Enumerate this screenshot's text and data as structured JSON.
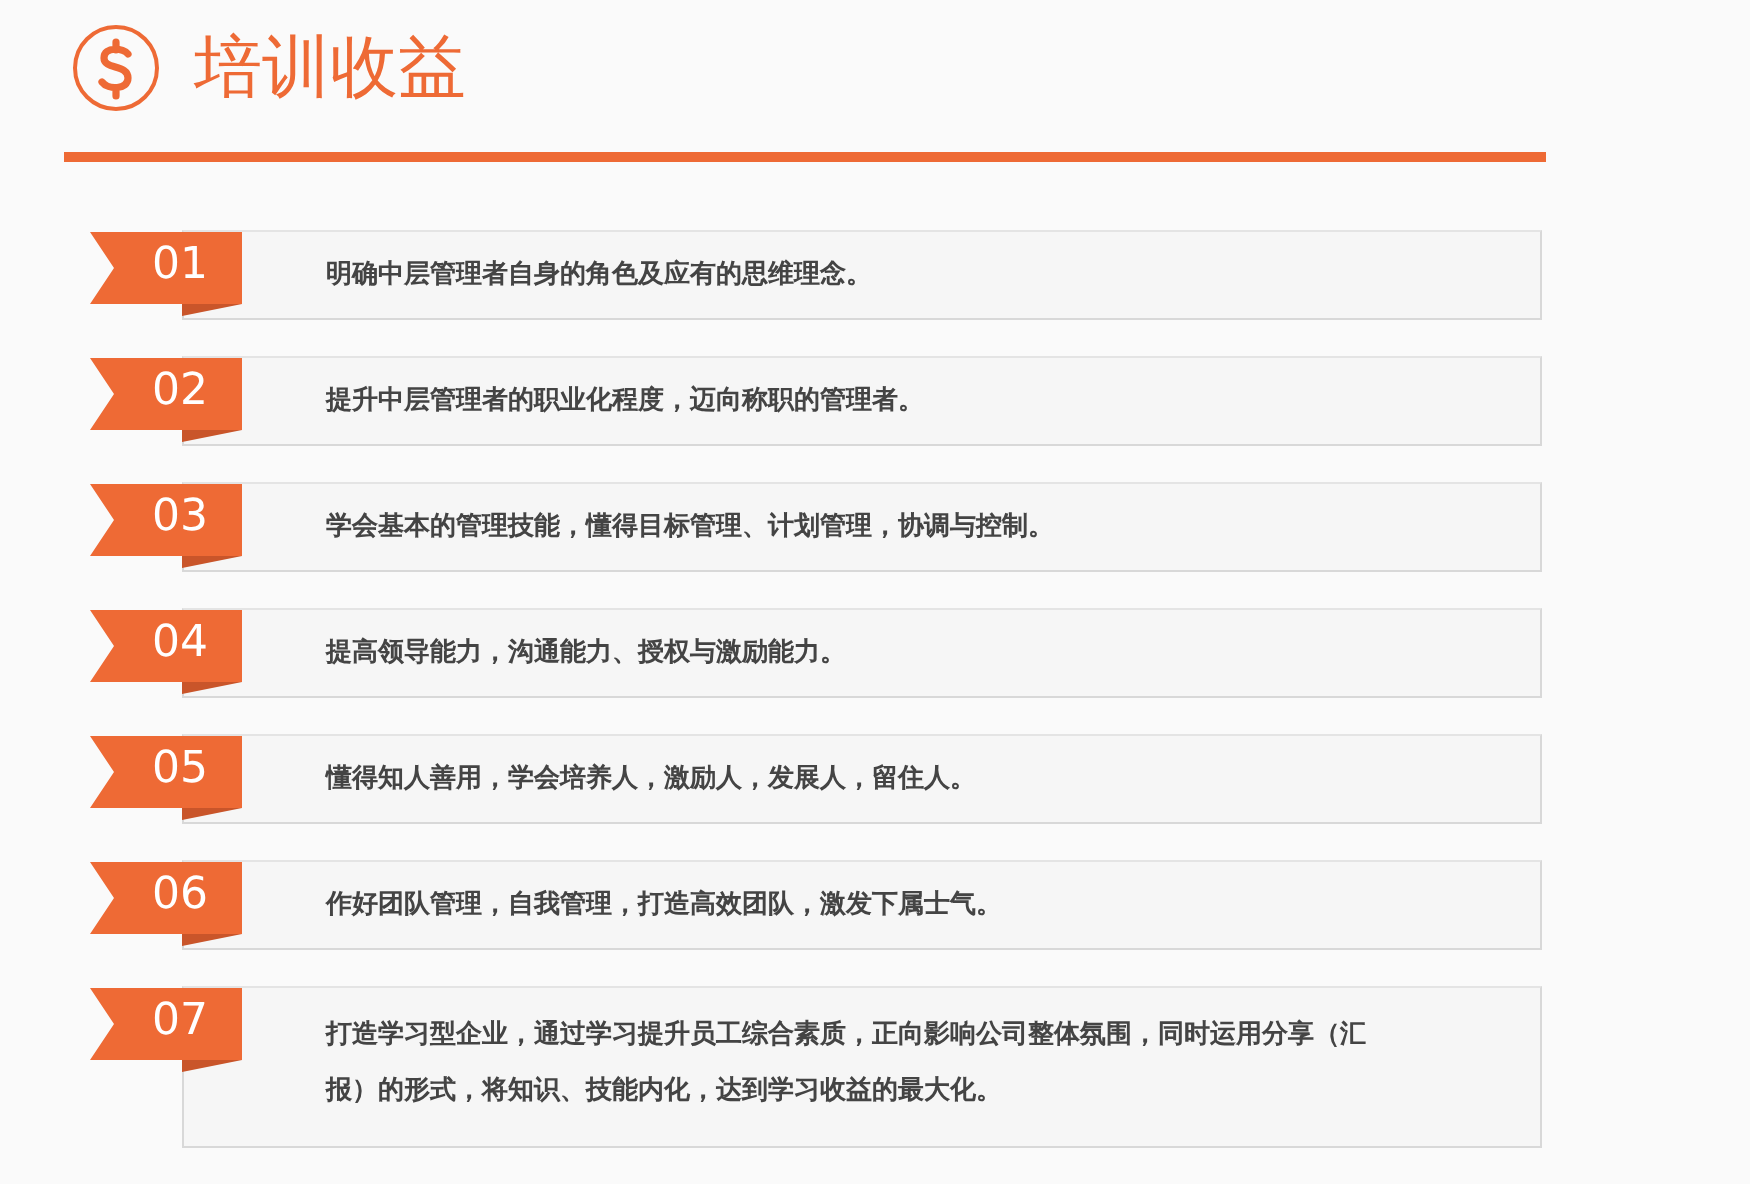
{
  "header": {
    "title": "培训收益"
  },
  "items": [
    {
      "number": "01",
      "text": "明确中层管理者自身的角色及应有的思维理念。"
    },
    {
      "number": "02",
      "text": "提升中层管理者的职业化程度，迈向称职的管理者。"
    },
    {
      "number": "03",
      "text": "学会基本的管理技能，懂得目标管理、计划管理，协调与控制。"
    },
    {
      "number": "04",
      "text": "提高领导能力，沟通能力、授权与激励能力。"
    },
    {
      "number": "05",
      "text": "懂得知人善用，学会培养人，激励人，发展人，留住人。"
    },
    {
      "number": "06",
      "text": "作好团队管理，自我管理，打造高效团队，激发下属士气。"
    },
    {
      "number": "07",
      "text": "打造学习型企业，通过学习提升员工综合素质，正向影响公司整体氛围，同时运用分享（汇报）的形式，将知识、技能内化，达到学习收益的最大化。"
    }
  ]
}
